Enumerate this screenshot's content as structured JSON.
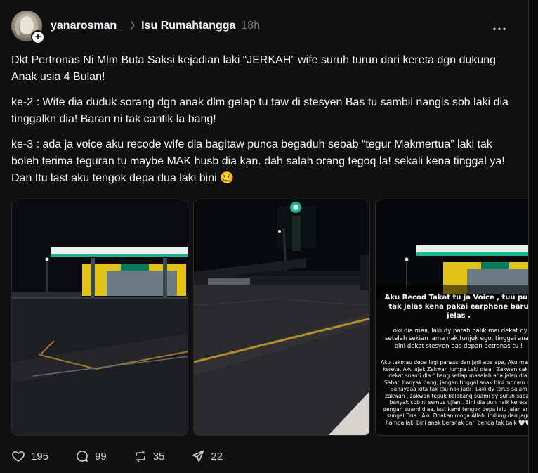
{
  "header": {
    "username": "yanarosman_",
    "community": "Isu Rumahtangga",
    "time": "18h",
    "more_icon": "more-horizontal-icon",
    "avatar_plus": "+"
  },
  "post": {
    "paragraphs": [
      "Dkt Pertronas Ni Mlm Buta Saksi kejadian laki “JERKAH” wife suruh turun dari kereta dgn dukung Anak usia 4 Bulan!",
      "ke-2 : Wife dia duduk sorang dgn anak dlm gelap tu taw di stesyen Bas tu sambil nangis sbb laki dia tinggalkn dia! Baran ni tak cantik la bang!",
      "ke-3 : ada ja voice aku recode wife dia bagitaw punca begaduh sebab “tegur Makmertua” laki tak boleh terima teguran tu maybe MAK husb dia kan. dah salah orang tegoq la! sekali kena tinggal ya! Dan Itu last aku tengok depa dua laki bini 🥴"
    ]
  },
  "media": {
    "overlay_heading": "Aku Recod Takat tu ja Voice , tuu pun tak jelas kena pakai earphone baru jelas .",
    "overlay_para1": "Loki dia maii, laki dy patah balik mai dekat dy setelah sekian lama nak tunjuk ego, tinggai anak bini dekat stesyen bas depan petronas tu !",
    "overlay_para2": "Aku takmau depa lagi panass dan jadi apa apa, Aku masuk kereta, Aku ajak Zakwan Jumpa Laki diaa . Zakwan cakap dekat suami dia \" bang setiap masalah ada jalan dia. Sabaq banyak bang, jangan tinggal anak bini mocam ni. Bahayaaa kita tak tau nok jadi . Laki dy terus salam zakwan , zakwan tepuk belakang suami dy suruh sabaq banyak sbb ni semua ujian . Bini dia pun naik kereta dengan suami diaa, last kami tengok depa lalu jalan area sungai Dua . Aku Doakan moga Allah lindung dan jaga hampa laki bini anak beranak dari benda tak baik 🤍🤍"
  },
  "actions": {
    "likes": "195",
    "comments": "99",
    "reposts": "35",
    "shares": "22"
  },
  "colors": {
    "background": "#101010",
    "text": "#f3f5f7",
    "muted": "#777777",
    "petronas_green": "#1fb58f"
  }
}
